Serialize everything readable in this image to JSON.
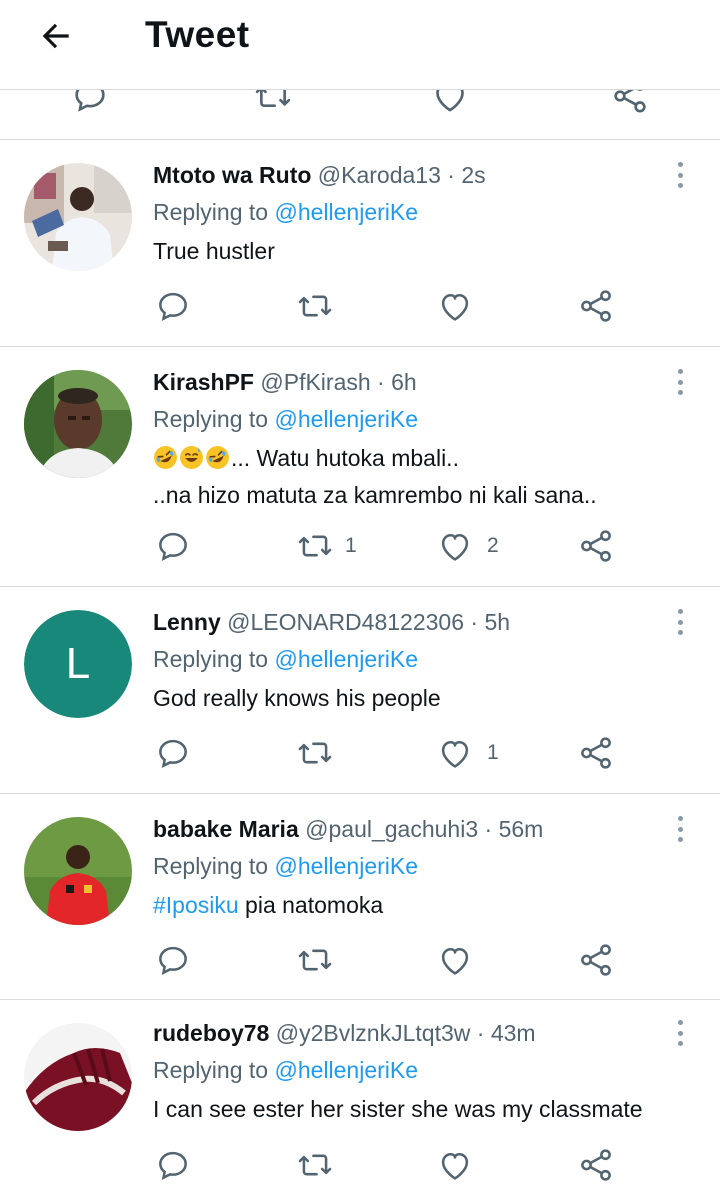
{
  "header": {
    "title": "Tweet"
  },
  "icons": {
    "back": "arrow-left-icon",
    "reply": "reply-bubble-icon",
    "retweet": "retweet-icon",
    "like": "heart-icon",
    "share": "share-icon",
    "more": "more-vertical-icon"
  },
  "colors": {
    "link": "#1d9bf0",
    "muted": "#536471",
    "text": "#0f1419"
  },
  "tweets": [
    {
      "name": "Mtoto wa Ruto",
      "handle": "@Karoda13",
      "dot": "·",
      "time": "2s",
      "replying_prefix": "Replying to",
      "replying_to": "@hellenjeriKe",
      "text": "True hustler",
      "retweets": "",
      "likes": ""
    },
    {
      "name": "KirashPF",
      "handle": "@PfKirash",
      "dot": "·",
      "time": "6h",
      "replying_prefix": "Replying to",
      "replying_to": "@hellenjeriKe",
      "text": "... Watu hutoka mbali..",
      "text_line2": "..na hizo matuta za kamrembo ni kali sana..",
      "emojis": [
        "rolling-on-floor-laughing-emoji",
        "grinning-sweat-emoji",
        "rolling-on-floor-laughing-emoji"
      ],
      "retweets": "1",
      "likes": "2"
    },
    {
      "name": "Lenny",
      "handle": "@LEONARD48122306",
      "dot": "·",
      "time": "5h",
      "replying_prefix": "Replying to",
      "replying_to": "@hellenjeriKe",
      "text": "God really knows his people",
      "avatar_letter": "L",
      "avatar_color": "#17887a",
      "retweets": "",
      "likes": "1"
    },
    {
      "name": "babake Maria",
      "handle": "@paul_gachuhi3",
      "dot": "·",
      "time": "56m",
      "replying_prefix": "Replying to",
      "replying_to": "@hellenjeriKe",
      "hashtag": "#Iposiku",
      "text": " pia natomoka",
      "retweets": "",
      "likes": ""
    },
    {
      "name": "rudeboy78",
      "handle": "@y2BvlznkJLtqt3w",
      "dot": "·",
      "time": "43m",
      "replying_prefix": "Replying to",
      "replying_to": "@hellenjeriKe",
      "text": "I can see ester her sister she was my classmate",
      "retweets": "",
      "likes": ""
    }
  ]
}
